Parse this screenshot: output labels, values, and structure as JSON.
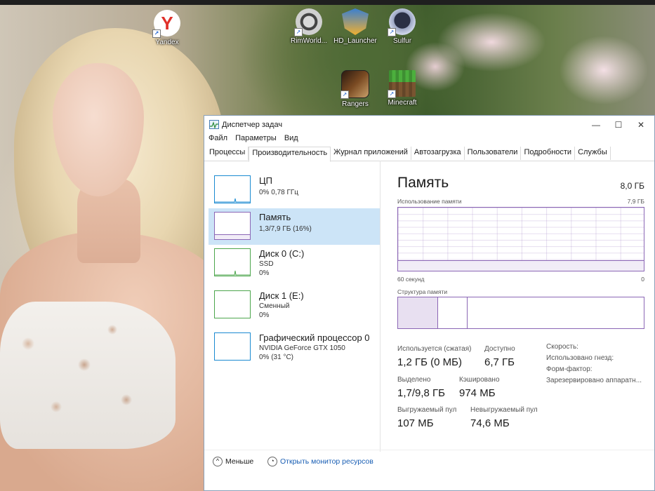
{
  "desktop": {
    "icons": [
      {
        "label": "Yandex"
      },
      {
        "label": "RimWorld..."
      },
      {
        "label": "HD_Launcher"
      },
      {
        "label": "Sulfur"
      },
      {
        "label": "Rangers"
      },
      {
        "label": "Minecraft"
      }
    ]
  },
  "window": {
    "title": "Диспетчер задач",
    "controls": {
      "minimize": "—",
      "maximize": "☐",
      "close": "✕"
    },
    "menu": [
      "Файл",
      "Параметры",
      "Вид"
    ],
    "tabs": [
      "Процессы",
      "Производительность",
      "Журнал приложений",
      "Автозагрузка",
      "Пользователи",
      "Подробности",
      "Службы"
    ],
    "active_tab": "Производительность"
  },
  "resources": [
    {
      "name": "ЦП",
      "line1": "0% 0,78 ГГц",
      "line2": "",
      "color": "#1a8ad1"
    },
    {
      "name": "Память",
      "line1": "1,3/7,9 ГБ (16%)",
      "line2": "",
      "color": "#8b66b5",
      "selected": true
    },
    {
      "name": "Диск 0 (C:)",
      "line1": "SSD",
      "line2": "0%",
      "color": "#4ca64c"
    },
    {
      "name": "Диск 1 (E:)",
      "line1": "Сменный",
      "line2": "0%",
      "color": "#4ca64c"
    },
    {
      "name": "Графический процессор 0",
      "line1": "NVIDIA GeForce GTX 1050",
      "line2": "0% (31 °C)",
      "color": "#1a8ad1"
    }
  ],
  "memory": {
    "title": "Память",
    "total": "8,0 ГБ",
    "usage_label": "Использование памяти",
    "usage_max": "7,9 ГБ",
    "axis_left": "60 секунд",
    "axis_right": "0",
    "usage_fraction": 0.16,
    "composition_label": "Структура памяти",
    "composition_used_fraction": 0.16,
    "composition_modified_fraction": 0.28,
    "stats": {
      "in_use_label": "Используется (сжатая)",
      "in_use_value": "1,2 ГБ (0 МБ)",
      "available_label": "Доступно",
      "available_value": "6,7 ГБ",
      "committed_label": "Выделено",
      "committed_value": "1,7/9,8 ГБ",
      "cached_label": "Кэшировано",
      "cached_value": "974 МБ",
      "paged_label": "Выгружаемый пул",
      "paged_value": "107 МБ",
      "nonpaged_label": "Невыгружаемый пул",
      "nonpaged_value": "74,6 МБ"
    },
    "props": [
      "Скорость:",
      "Использовано гнезд:",
      "Форм-фактор:",
      "Зарезервировано аппаратн..."
    ]
  },
  "footer": {
    "less": "Меньше",
    "resource_monitor": "Открыть монитор ресурсов"
  },
  "colors": {
    "memory_accent": "#8b66b5",
    "cpu_accent": "#1a8ad1",
    "disk_accent": "#4ca64c",
    "selection": "#cce4f7"
  }
}
